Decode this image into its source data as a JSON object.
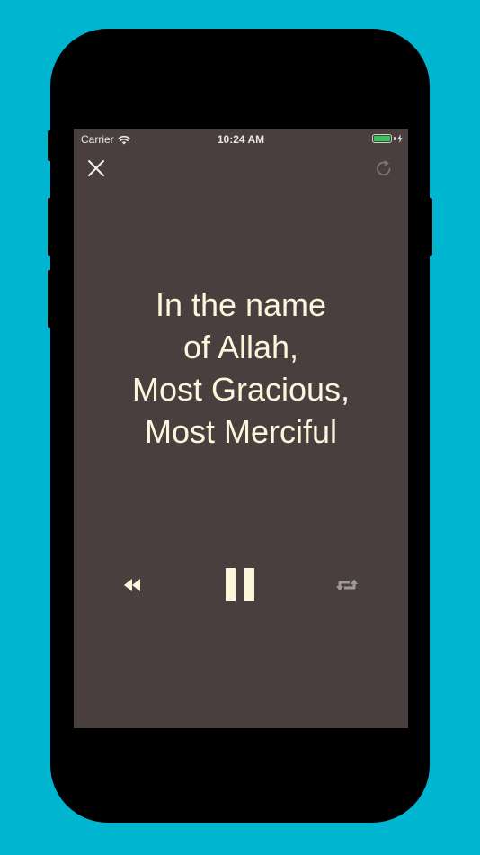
{
  "status_bar": {
    "carrier": "Carrier",
    "time": "10:24 AM",
    "battery_level": 1.0
  },
  "top_bar": {
    "close_icon": "close-icon",
    "reload_icon": "reload-icon"
  },
  "verse": {
    "lines": [
      "In the name",
      "of Allah,",
      "Most Gracious,",
      "Most Merciful"
    ]
  },
  "controls": {
    "rewind_icon": "rewind-icon",
    "pause_icon": "pause-icon",
    "repeat_icon": "repeat-icon"
  },
  "colors": {
    "background": "#00b5d0",
    "screen": "#4a3f3f",
    "text": "#fdf5dc",
    "control_muted": "#9e9a9a",
    "battery": "#34c759"
  }
}
